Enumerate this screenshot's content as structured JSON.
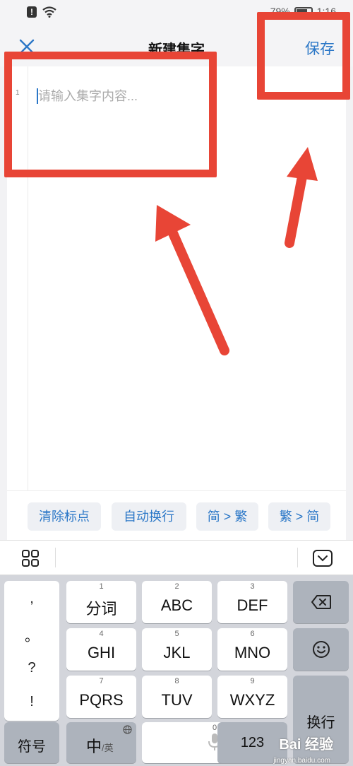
{
  "status_bar": {
    "battery": "79%",
    "time": "1:16"
  },
  "header": {
    "title": "新建集字",
    "save_label": "保存"
  },
  "editor": {
    "line_number": "1",
    "placeholder": "请输入集字内容..."
  },
  "actions": [
    {
      "label": "清除标点"
    },
    {
      "label": "自动换行"
    },
    {
      "label": "简 > 繁"
    },
    {
      "label": "繁 > 简"
    }
  ],
  "punctuation": [
    ",",
    "。",
    "?",
    "!"
  ],
  "keys": {
    "row1": [
      {
        "num": "1",
        "label": "分词"
      },
      {
        "num": "2",
        "label": "ABC"
      },
      {
        "num": "3",
        "label": "DEF"
      }
    ],
    "row2": [
      {
        "num": "4",
        "label": "GHI"
      },
      {
        "num": "5",
        "label": "JKL"
      },
      {
        "num": "6",
        "label": "MNO"
      }
    ],
    "row3": [
      {
        "num": "7",
        "label": "PQRS"
      },
      {
        "num": "8",
        "label": "TUV"
      },
      {
        "num": "9",
        "label": "WXYZ"
      }
    ],
    "symbols": "符号",
    "lang_main": "中",
    "lang_sub": "/英",
    "space_num": "0",
    "numbers": "123",
    "enter": "换行"
  },
  "watermark": {
    "main": "Bai 经验",
    "sub": "jingyan.baidu.com"
  },
  "colors": {
    "accent": "#2b77c7",
    "annotation": "#e84536",
    "keyboard_bg": "#d3d5db"
  },
  "icons": {
    "close": "close-icon",
    "grid": "grid-icon",
    "collapse": "keyboard-collapse-icon",
    "backspace": "backspace-icon",
    "emoji": "emoji-icon",
    "mic": "microphone-icon",
    "globe": "globe-icon"
  }
}
